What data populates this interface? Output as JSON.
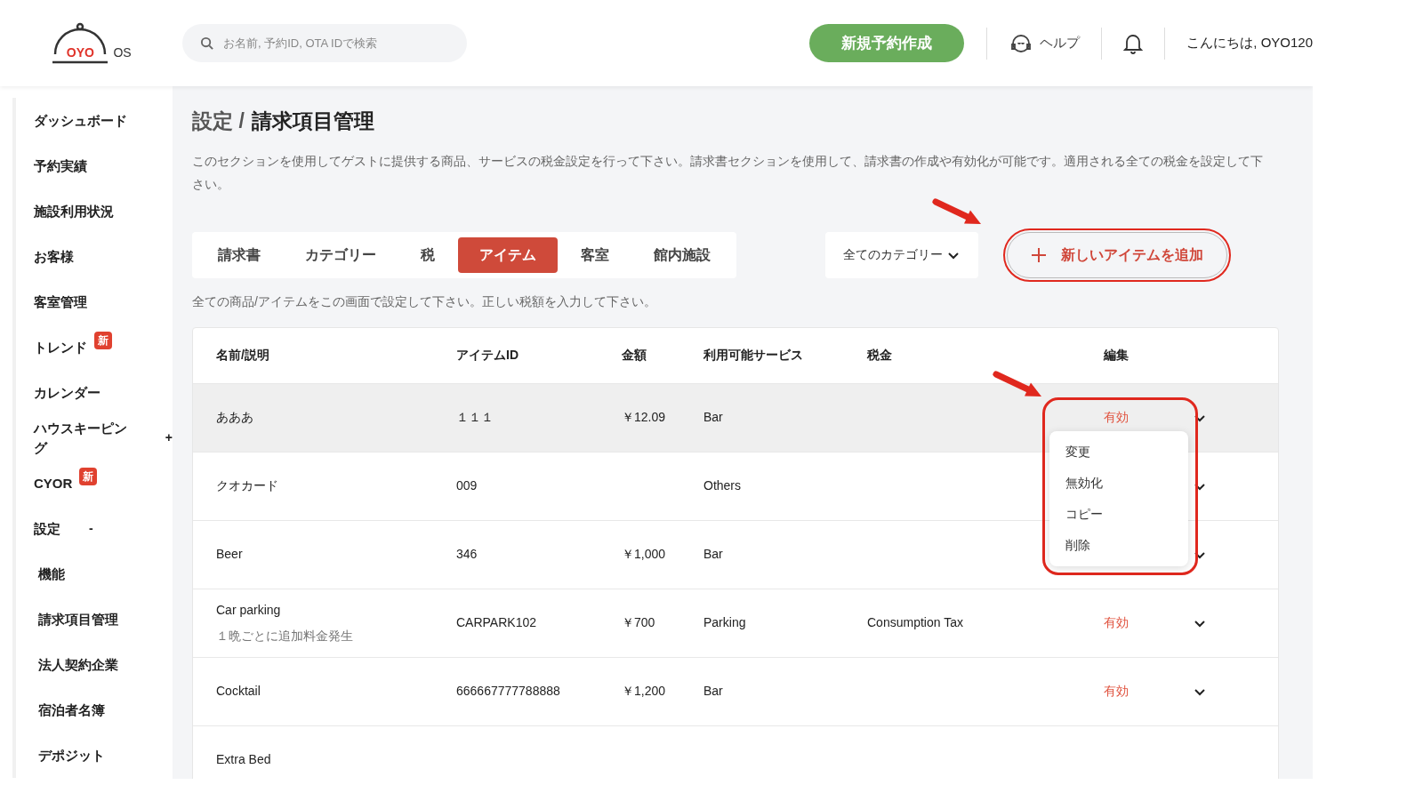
{
  "header": {
    "logo": "OYO",
    "logo_suffix": "OS",
    "search": {
      "placeholder": "お名前, 予約ID, OTA IDで検索"
    },
    "new_booking": "新規予約作成",
    "help": "ヘルプ",
    "greeting": "こんにちは, OYO120"
  },
  "sidebar": {
    "items": [
      {
        "label": "ダッシュボード",
        "selected": false
      },
      {
        "label": "予約実績",
        "selected": false
      },
      {
        "label": "施設利用状況",
        "selected": false
      },
      {
        "label": "お客様",
        "selected": false
      },
      {
        "label": "客室管理",
        "selected": false
      },
      {
        "label": "トレンド",
        "badge": "新",
        "selected": false
      },
      {
        "label": "カレンダー",
        "selected": false
      },
      {
        "label": "ハウスキーピング",
        "toggle": "+",
        "selected": false
      },
      {
        "label": "CYOR",
        "badge": "新",
        "selected": false
      },
      {
        "label": "設定",
        "toggle": "-",
        "selected": false,
        "children": [
          {
            "label": "機能",
            "selected": false
          },
          {
            "label": "請求項目管理",
            "selected": false
          },
          {
            "label": "法人契約企業",
            "selected": false
          },
          {
            "label": "宿泊者名簿",
            "selected": false
          },
          {
            "label": "デポジット",
            "selected": false
          }
        ]
      }
    ]
  },
  "page": {
    "breadcrumb_parent": "設定 /",
    "title": "請求項目管理",
    "description": "このセクションを使用してゲストに提供する商品、サービスの税金設定を行って下さい。請求書セクションを使用して、請求書の作成や有効化が可能です。適用される全ての税金を設定して下さい。",
    "tabs": [
      {
        "label": "請求書",
        "selected": false
      },
      {
        "label": "カテゴリー",
        "selected": false
      },
      {
        "label": "税",
        "selected": false
      },
      {
        "label": "アイテム",
        "selected": true
      },
      {
        "label": "客室",
        "selected": false
      },
      {
        "label": "館内施設",
        "selected": false
      }
    ],
    "category_filter": "全てのカテゴリー",
    "add_button": "新しいアイテムを追加",
    "hint": "全ての商品/アイテムをこの画面で設定して下さい。正しい税額を入力して下さい。"
  },
  "table": {
    "columns": [
      "名前/説明",
      "アイテムID",
      "金額",
      "利用可能サービス",
      "税金",
      "編集"
    ],
    "rows": [
      {
        "name": "あああ",
        "id": "１１１",
        "amount": "￥12.09",
        "service": "Bar",
        "status": "有効",
        "highlighted": true
      },
      {
        "name": "クオカード",
        "id": "009",
        "service": "Others",
        "highlighted": false
      },
      {
        "name": "Beer",
        "id": "346",
        "amount": "￥1,000",
        "service": "Bar",
        "highlighted": false
      },
      {
        "name": "Car parking",
        "note": "１晩ごとに追加料金発生",
        "id": "CARPARK102",
        "amount": "￥700",
        "service": "Parking",
        "tax": "Consumption Tax",
        "status": "有効",
        "highlighted": false
      },
      {
        "name": "Cocktail",
        "id": "666667777788888",
        "amount": "￥1,200",
        "service": "Bar",
        "status": "有効",
        "highlighted": false
      },
      {
        "name": "Extra Bed",
        "highlighted": false
      }
    ]
  },
  "action_menu": {
    "items": [
      "変更",
      "無効化",
      "コピー",
      "削除"
    ]
  }
}
